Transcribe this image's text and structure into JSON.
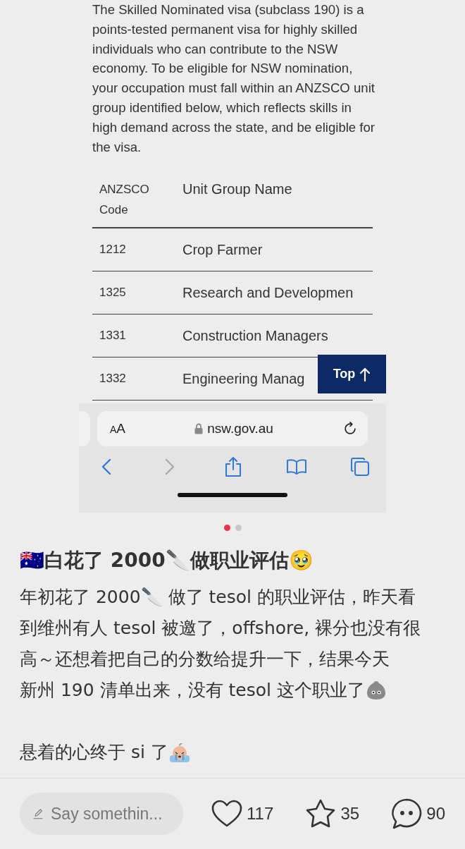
{
  "nsw_page": {
    "intro": "The Skilled Nominated visa (subclass 190) is a points-tested permanent visa for highly skilled individuals who can contribute to the NSW economy. To be eligible for NSW nomination, your occupation must fall within an ANZSCO unit group identified below, which reflects skills in high demand across the state, and be eligible for the visa.",
    "table": {
      "columns": [
        "ANZSCO Code",
        "Unit Group Name"
      ],
      "rows": [
        {
          "code": "1212",
          "name": "Crop Farmer"
        },
        {
          "code": "1325",
          "name": "Research and Developmen"
        },
        {
          "code": "1331",
          "name": "Construction Managers"
        },
        {
          "code": "1332",
          "name": "Engineering Manag"
        }
      ]
    },
    "top_button": "Top"
  },
  "browser": {
    "text_size": "AA",
    "url": "nsw.gov.au",
    "back_enabled": true,
    "forward_enabled": false
  },
  "pages": [
    {
      "selected": true
    },
    {
      "selected": false
    }
  ],
  "post": {
    "title": "🇦🇺白花了 2000🔪做职业评估🥹",
    "paragraphs": [
      {
        "kind": "stone",
        "lines": [
          "年初花了 2000🔪 做了 tesol 的职业评估，昨天看",
          "到维州有人 tesol 被邀了，offshore, 裸分也没有很",
          "高～还想着把自己的分数给提升一下，结果今天",
          "新州 190 清单出来，没有 tesol 这个职业了"
        ]
      },
      {
        "kind": "crying",
        "lines": [
          "悬着的心终于 si 了"
        ]
      }
    ]
  },
  "bottom_bar": {
    "comment_field": {
      "placeholder": "Say somethin..."
    },
    "likes": "117",
    "favorites": "35",
    "comments": "90"
  }
}
